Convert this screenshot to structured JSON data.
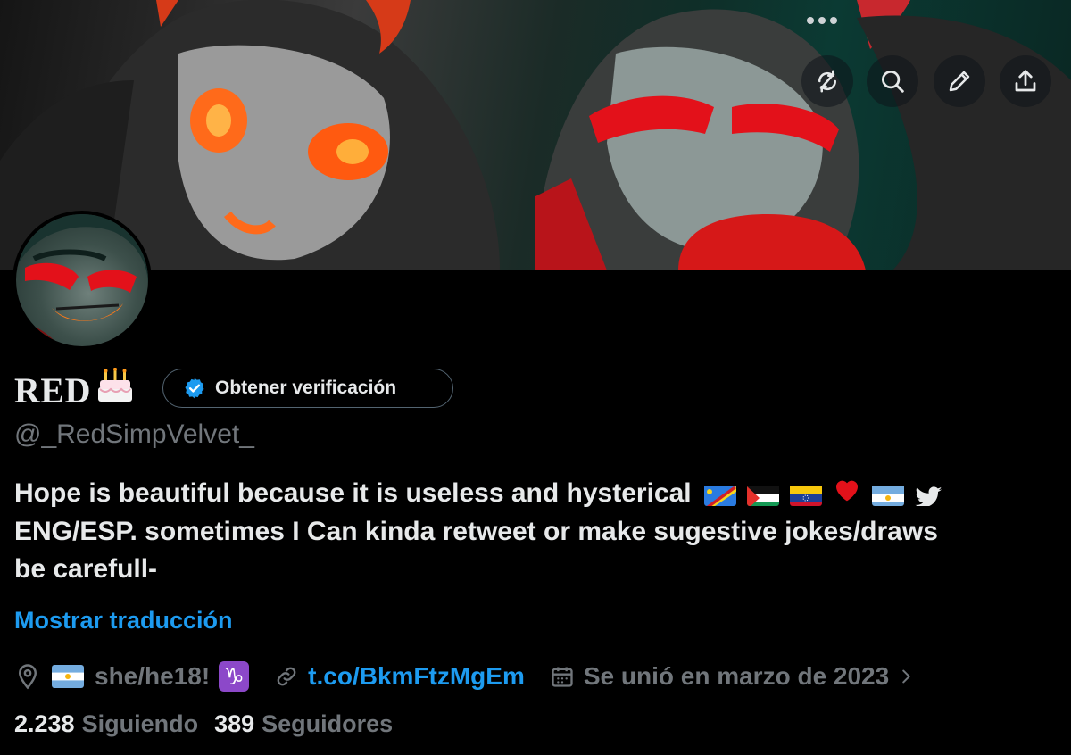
{
  "profile": {
    "name": "RED",
    "handle": "@_RedSimpVelvet_",
    "verify_label": "Obtener verificación",
    "bio_line1": "Hope is beautiful because it is useless and hysterical",
    "bio_line2": "ENG/ESP. sometimes I Can kinda retweet or make sugestive jokes/draws",
    "bio_line3": "be carefull-",
    "translate_label": "Mostrar traducción",
    "location": "she/he18!",
    "link": "t.co/BkmFtzMgEm",
    "joined": "Se unió en marzo de 2023",
    "following_count": "2.238",
    "following_label": "Siguiendo",
    "followers_count": "389",
    "followers_label": "Seguidores"
  },
  "icons": {
    "more": "more-horizontal-icon",
    "refresh": "refresh-icon",
    "search": "search-icon",
    "edit": "pencil-icon",
    "share": "share-icon",
    "verified": "verified-badge-icon",
    "location": "location-pin-icon",
    "link": "link-icon",
    "calendar": "calendar-icon",
    "chevron": "chevron-right-icon"
  },
  "colors": {
    "background": "#000000",
    "text": "#e7e9ea",
    "muted": "#71767b",
    "accent": "#1d9bf0",
    "border": "#536471"
  }
}
